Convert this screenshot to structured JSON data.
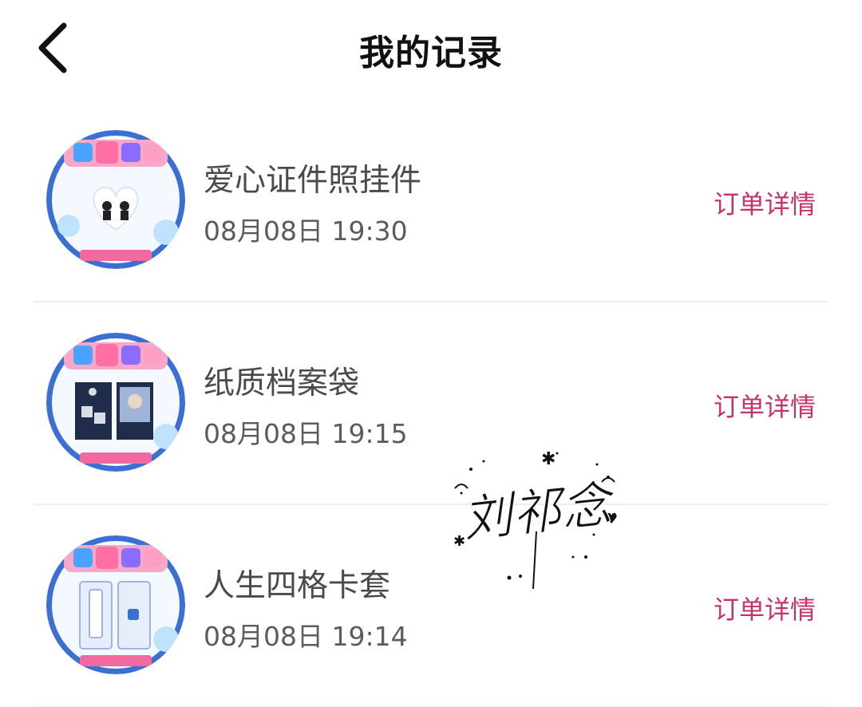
{
  "header": {
    "title": "我的记录",
    "back_icon": "back-arrow-icon"
  },
  "colors": {
    "detail_link": "#c8326a",
    "text_primary": "#4a4a4a",
    "text_secondary": "#5c5c5c",
    "divider": "#eeeeee"
  },
  "records": [
    {
      "name": "爱心证件照挂件",
      "time": "08月08日 19:30",
      "detail_label": "订单详情",
      "thumbnail_icon": "heart-badge-keychain-thumbnail"
    },
    {
      "name": "纸质档案袋",
      "time": "08月08日 19:15",
      "detail_label": "订单详情",
      "thumbnail_icon": "paper-file-bag-thumbnail"
    },
    {
      "name": "人生四格卡套",
      "time": "08月08日 19:14",
      "detail_label": "订单详情",
      "thumbnail_icon": "photo-card-sleeve-thumbnail"
    }
  ],
  "watermark": {
    "text": "刘祁念"
  }
}
